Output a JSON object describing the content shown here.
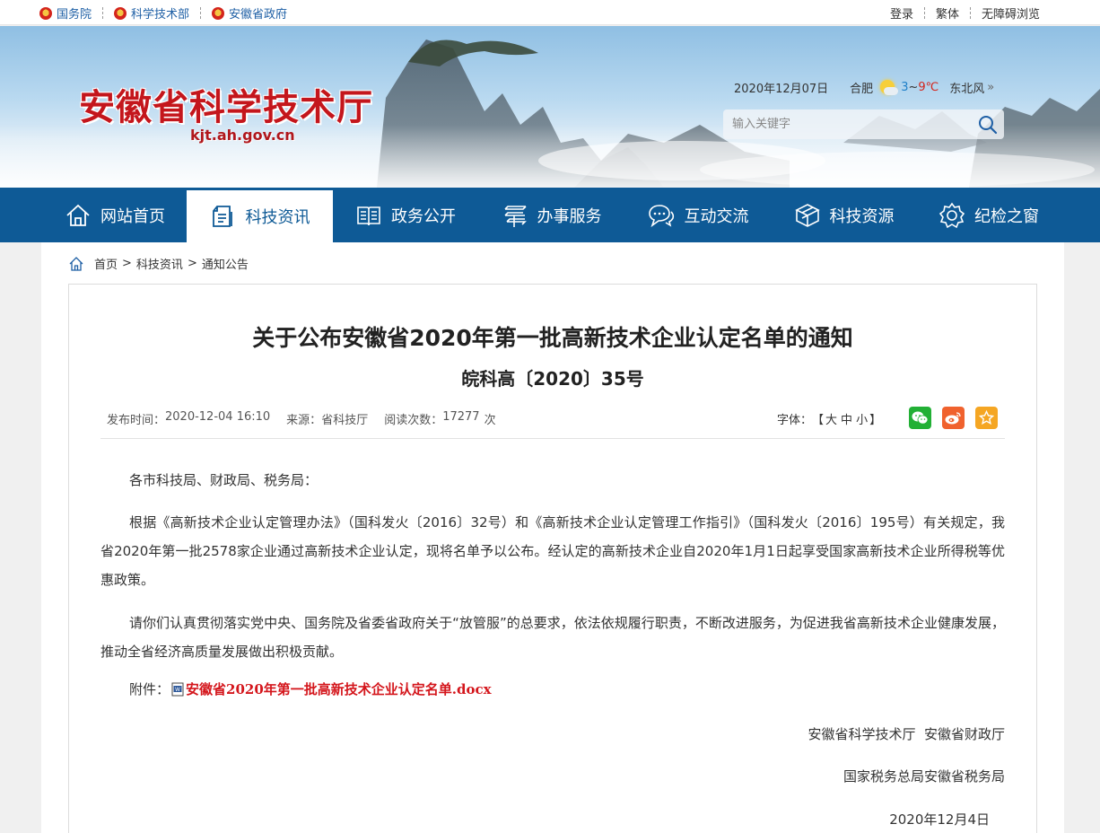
{
  "topbar": {
    "links": [
      "国务院",
      "科学技术部",
      "安徽省政府"
    ],
    "login": "登录",
    "traditional": "繁体",
    "accessible": "无障碍浏览"
  },
  "header": {
    "title": "安徽省科学技术厅",
    "domain": "kjt.ah.gov.cn",
    "date": "2020年12月07日",
    "city": "合肥",
    "temp_low": "3",
    "temp_sep": "~",
    "temp_high": "9℃",
    "wind": "东北风",
    "search_placeholder": "输入关键字"
  },
  "nav": {
    "items": [
      "网站首页",
      "科技资讯",
      "政务公开",
      "办事服务",
      "互动交流",
      "科技资源",
      "纪检之窗"
    ],
    "active_index": 1
  },
  "breadcrumb": {
    "home": "首页",
    "sep": ">",
    "section": "科技资讯",
    "current": "通知公告"
  },
  "article": {
    "title": "关于公布安徽省2020年第一批高新技术企业认定名单的通知",
    "doc_number": "皖科高〔2020〕35号",
    "publish_label": "发布时间：",
    "publish_time": "2020-12-04 16:10",
    "source_label": "来源：",
    "source": "省科技厅",
    "views_label": "阅读次数：",
    "views": "17277",
    "views_unit": "次",
    "font_label": "字体：",
    "font_open": "【",
    "font_large": "大",
    "font_medium": "中",
    "font_small": "小",
    "font_close": "】",
    "salutation": "各市科技局、财政局、税务局：",
    "paragraph1": "根据《高新技术企业认定管理办法》（国科发火〔2016〕32号）和《高新技术企业认定管理工作指引》（国科发火〔2016〕195号）有关规定，我省2020年第一批2578家企业通过高新技术企业认定，现将名单予以公布。经认定的高新技术企业自2020年1月1日起享受国家高新技术企业所得税等优惠政策。",
    "paragraph2": "请你们认真贯彻落实党中央、国务院及省委省政府关于“放管服”的总要求，依法依规履行职责，不断改进服务，为促进我省高新技术企业健康发展，推动全省经济高质量发展做出积极贡献。",
    "attachment_label": "附件：",
    "attachment_name": "安徽省2020年第一批高新技术企业认定名单.docx",
    "signer1": "安徽省科学技术厅  安徽省财政厅",
    "signer2": "国家税务总局安徽省税务局",
    "sign_date": "2020年12月4日"
  },
  "colors": {
    "brand_red": "#c4161c",
    "nav_blue": "#0e5a96",
    "link_blue": "#1e5fa5",
    "attachment_red": "#d4161c"
  }
}
